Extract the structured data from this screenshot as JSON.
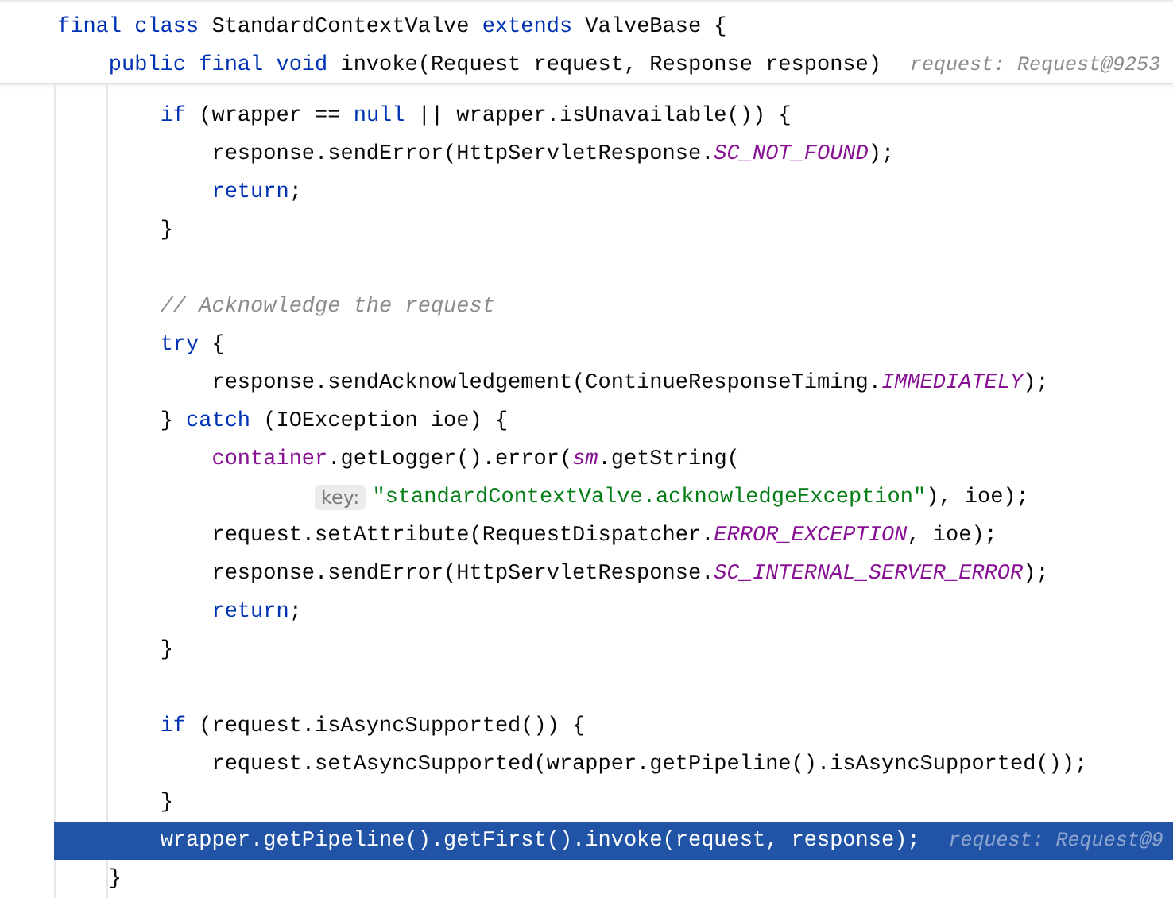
{
  "sticky_header": {
    "lines": [
      {
        "segments": [
          {
            "text": "final class ",
            "kind": "kw"
          },
          {
            "text": "StandardContextValve ",
            "kind": "plain"
          },
          {
            "text": "extends ",
            "kind": "kw"
          },
          {
            "text": "ValveBase {",
            "kind": "plain"
          }
        ]
      },
      {
        "segments": [
          {
            "text": "    public final void ",
            "kind": "kw"
          },
          {
            "text": "invoke(Request request, Response response)",
            "kind": "plain"
          },
          {
            "text": "request: Request@9253",
            "kind": "hint"
          }
        ]
      }
    ]
  },
  "editor": {
    "lines": [
      {
        "current": false,
        "segments": [
          {
            "text": "        if",
            "kind": "kw"
          },
          {
            "text": " (wrapper == ",
            "kind": "plain"
          },
          {
            "text": "null",
            "kind": "kw"
          },
          {
            "text": " || wrapper.isUnavailable()) {",
            "kind": "plain"
          }
        ]
      },
      {
        "current": false,
        "segments": [
          {
            "text": "            response.sendError(HttpServletResponse.",
            "kind": "plain"
          },
          {
            "text": "SC_NOT_FOUND",
            "kind": "const"
          },
          {
            "text": ");",
            "kind": "plain"
          }
        ]
      },
      {
        "current": false,
        "segments": [
          {
            "text": "            return",
            "kind": "kw"
          },
          {
            "text": ";",
            "kind": "plain"
          }
        ]
      },
      {
        "current": false,
        "segments": [
          {
            "text": "        }",
            "kind": "plain"
          }
        ]
      },
      {
        "current": false
      },
      {
        "current": false,
        "segments": [
          {
            "text": "        // Acknowledge the request",
            "kind": "comment"
          }
        ]
      },
      {
        "current": false,
        "segments": [
          {
            "text": "        try",
            "kind": "kw"
          },
          {
            "text": " {",
            "kind": "plain"
          }
        ]
      },
      {
        "current": false,
        "segments": [
          {
            "text": "            response.sendAcknowledgement(ContinueResponseTiming.",
            "kind": "plain"
          },
          {
            "text": "IMMEDIATELY",
            "kind": "const"
          },
          {
            "text": ");",
            "kind": "plain"
          }
        ]
      },
      {
        "current": false,
        "segments": [
          {
            "text": "        } ",
            "kind": "plain"
          },
          {
            "text": "catch",
            "kind": "kw"
          },
          {
            "text": " (IOException ioe) {",
            "kind": "plain"
          }
        ]
      },
      {
        "current": false,
        "segments": [
          {
            "text": "            container",
            "kind": "field"
          },
          {
            "text": ".getLogger().error(",
            "kind": "plain"
          },
          {
            "text": "sm",
            "kind": "static"
          },
          {
            "text": ".getString(",
            "kind": "plain"
          }
        ]
      },
      {
        "current": false,
        "segments": [
          {
            "text": "                    key:",
            "kind": "chip"
          },
          {
            "text": "\"standardContextValve.acknowledgeException\"",
            "kind": "string"
          },
          {
            "text": "), ioe);",
            "kind": "plain"
          }
        ]
      },
      {
        "current": false,
        "segments": [
          {
            "text": "            request.setAttribute(RequestDispatcher.",
            "kind": "plain"
          },
          {
            "text": "ERROR_EXCEPTION",
            "kind": "const"
          },
          {
            "text": ", ioe);",
            "kind": "plain"
          }
        ]
      },
      {
        "current": false,
        "segments": [
          {
            "text": "            response.sendError(HttpServletResponse.",
            "kind": "plain"
          },
          {
            "text": "SC_INTERNAL_SERVER_ERROR",
            "kind": "const"
          },
          {
            "text": ");",
            "kind": "plain"
          }
        ]
      },
      {
        "current": false,
        "segments": [
          {
            "text": "            return",
            "kind": "kw"
          },
          {
            "text": ";",
            "kind": "plain"
          }
        ]
      },
      {
        "current": false,
        "segments": [
          {
            "text": "        }",
            "kind": "plain"
          }
        ]
      },
      {
        "current": false
      },
      {
        "current": false,
        "segments": [
          {
            "text": "        if",
            "kind": "kw"
          },
          {
            "text": " (request.isAsyncSupported()) {",
            "kind": "plain"
          }
        ]
      },
      {
        "current": false,
        "segments": [
          {
            "text": "            request.setAsyncSupported(wrapper.getPipeline().isAsyncSupported());",
            "kind": "plain"
          }
        ]
      },
      {
        "current": false,
        "segments": [
          {
            "text": "        }",
            "kind": "plain"
          }
        ]
      },
      {
        "current": true,
        "segments": [
          {
            "text": "        wrapper.getPipeline().getFirst().invoke(request, response);",
            "kind": "plain"
          },
          {
            "text": "request: Request@9",
            "kind": "hint"
          }
        ]
      },
      {
        "current": false,
        "segments": [
          {
            "text": "    }",
            "kind": "plain"
          }
        ]
      }
    ]
  }
}
